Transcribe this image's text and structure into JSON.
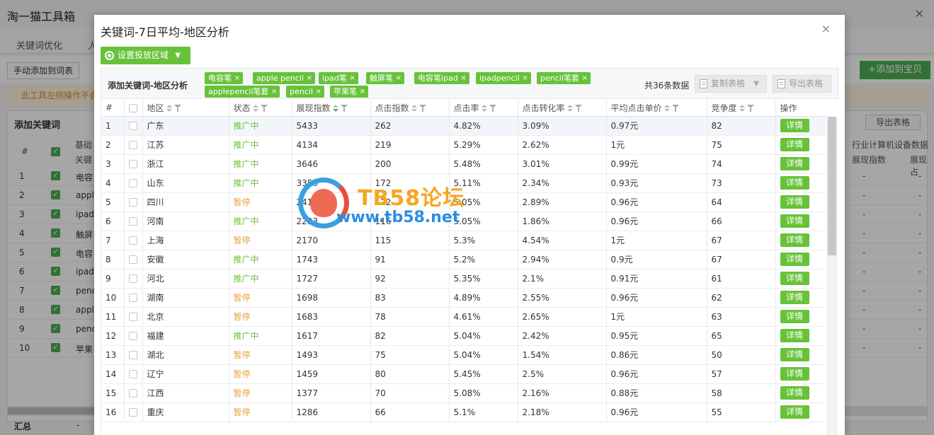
{
  "app": {
    "title": "淘一猫工具箱",
    "tabs": [
      "关键词优化",
      "人"
    ],
    "manual_add_label": "手动添加到词表",
    "add_product_label": "+添加到宝贝",
    "warning_text": "此工具左侧操作不会",
    "panel_title": "添加关键词",
    "export_label": "导出表格",
    "col_num": "#",
    "col_basic": "基础",
    "col_keyword": "关键",
    "col_industry": "行业计算机设备数据",
    "col_show_index": "展现指数",
    "col_show_share": "展现占",
    "rows": [
      {
        "num": "1",
        "kw": "电容"
      },
      {
        "num": "2",
        "kw": "apple"
      },
      {
        "num": "3",
        "kw": "ipad"
      },
      {
        "num": "4",
        "kw": "触屏"
      },
      {
        "num": "5",
        "kw": "电容"
      },
      {
        "num": "6",
        "kw": "ipadp"
      },
      {
        "num": "7",
        "kw": "penc"
      },
      {
        "num": "8",
        "kw": "apple"
      },
      {
        "num": "9",
        "kw": "penc"
      },
      {
        "num": "10",
        "kw": "苹果"
      }
    ],
    "dash": "-",
    "total_label": "汇总"
  },
  "modal": {
    "title": "关键词-7日平均-地区分析",
    "region_button": "设置投放区域",
    "filter_label": "添加关键词-地区分析",
    "tags": [
      "电容笔",
      "apple pencil",
      "ipad笔",
      "触屏笔",
      "电容笔ipad",
      "ipadpencil",
      "pencil笔套",
      "applepencil笔套",
      "pencil",
      "苹果笔"
    ],
    "tag_close": "×",
    "count_text": "共36条数据",
    "copy_button": "复制表格",
    "export_button": "导出表格",
    "columns": {
      "num": "#",
      "region": "地区",
      "status": "状态",
      "show_index": "展现指数",
      "click_index": "点击指数",
      "ctr": "点击率",
      "cvr": "点击转化率",
      "avg_price": "平均点击单价",
      "competition": "竞争度",
      "action": "操作"
    },
    "detail_label": "详情",
    "rows": [
      {
        "num": "1",
        "region": "广东",
        "status": "推广中",
        "on": true,
        "show": "5433",
        "click": "262",
        "ctr": "4.82%",
        "cvr": "3.09%",
        "price": "0.97元",
        "comp": "82"
      },
      {
        "num": "2",
        "region": "江苏",
        "status": "推广中",
        "on": true,
        "show": "4134",
        "click": "219",
        "ctr": "5.29%",
        "cvr": "2.62%",
        "price": "1元",
        "comp": "75"
      },
      {
        "num": "3",
        "region": "浙江",
        "status": "推广中",
        "on": true,
        "show": "3646",
        "click": "200",
        "ctr": "5.48%",
        "cvr": "3.01%",
        "price": "0.99元",
        "comp": "74"
      },
      {
        "num": "4",
        "region": "山东",
        "status": "推广中",
        "on": true,
        "show": "3356",
        "click": "172",
        "ctr": "5.11%",
        "cvr": "2.34%",
        "price": "0.93元",
        "comp": "73"
      },
      {
        "num": "5",
        "region": "四川",
        "status": "暂停",
        "on": false,
        "show": "2415",
        "click": "122",
        "ctr": "5.05%",
        "cvr": "2.89%",
        "price": "0.96元",
        "comp": "64"
      },
      {
        "num": "6",
        "region": "河南",
        "status": "推广中",
        "on": true,
        "show": "2293",
        "click": "116",
        "ctr": "5.05%",
        "cvr": "1.86%",
        "price": "0.96元",
        "comp": "66"
      },
      {
        "num": "7",
        "region": "上海",
        "status": "暂停",
        "on": false,
        "show": "2170",
        "click": "115",
        "ctr": "5.3%",
        "cvr": "4.54%",
        "price": "1元",
        "comp": "67"
      },
      {
        "num": "8",
        "region": "安徽",
        "status": "推广中",
        "on": true,
        "show": "1743",
        "click": "91",
        "ctr": "5.2%",
        "cvr": "2.94%",
        "price": "0.9元",
        "comp": "67"
      },
      {
        "num": "9",
        "region": "河北",
        "status": "推广中",
        "on": true,
        "show": "1727",
        "click": "92",
        "ctr": "5.35%",
        "cvr": "2.1%",
        "price": "0.91元",
        "comp": "61"
      },
      {
        "num": "10",
        "region": "湖南",
        "status": "暂停",
        "on": false,
        "show": "1698",
        "click": "83",
        "ctr": "4.89%",
        "cvr": "2.55%",
        "price": "0.96元",
        "comp": "62"
      },
      {
        "num": "11",
        "region": "北京",
        "status": "暂停",
        "on": false,
        "show": "1683",
        "click": "78",
        "ctr": "4.61%",
        "cvr": "2.65%",
        "price": "1元",
        "comp": "63"
      },
      {
        "num": "12",
        "region": "福建",
        "status": "推广中",
        "on": true,
        "show": "1617",
        "click": "82",
        "ctr": "5.04%",
        "cvr": "2.42%",
        "price": "0.95元",
        "comp": "65"
      },
      {
        "num": "13",
        "region": "湖北",
        "status": "暂停",
        "on": false,
        "show": "1493",
        "click": "75",
        "ctr": "5.04%",
        "cvr": "1.54%",
        "price": "0.86元",
        "comp": "50"
      },
      {
        "num": "14",
        "region": "辽宁",
        "status": "暂停",
        "on": false,
        "show": "1459",
        "click": "80",
        "ctr": "5.45%",
        "cvr": "2.5%",
        "price": "0.96元",
        "comp": "57"
      },
      {
        "num": "15",
        "region": "江西",
        "status": "暂停",
        "on": false,
        "show": "1377",
        "click": "70",
        "ctr": "5.08%",
        "cvr": "2.16%",
        "price": "0.88元",
        "comp": "58"
      },
      {
        "num": "16",
        "region": "重庆",
        "status": "暂停",
        "on": false,
        "show": "1286",
        "click": "66",
        "ctr": "5.1%",
        "cvr": "2.18%",
        "price": "0.96元",
        "comp": "55"
      }
    ]
  },
  "watermark": {
    "text1": "TB58论坛",
    "text2": "www.tb58.net"
  },
  "colors": {
    "green": "#67c23a",
    "orange": "#e6a23c"
  }
}
